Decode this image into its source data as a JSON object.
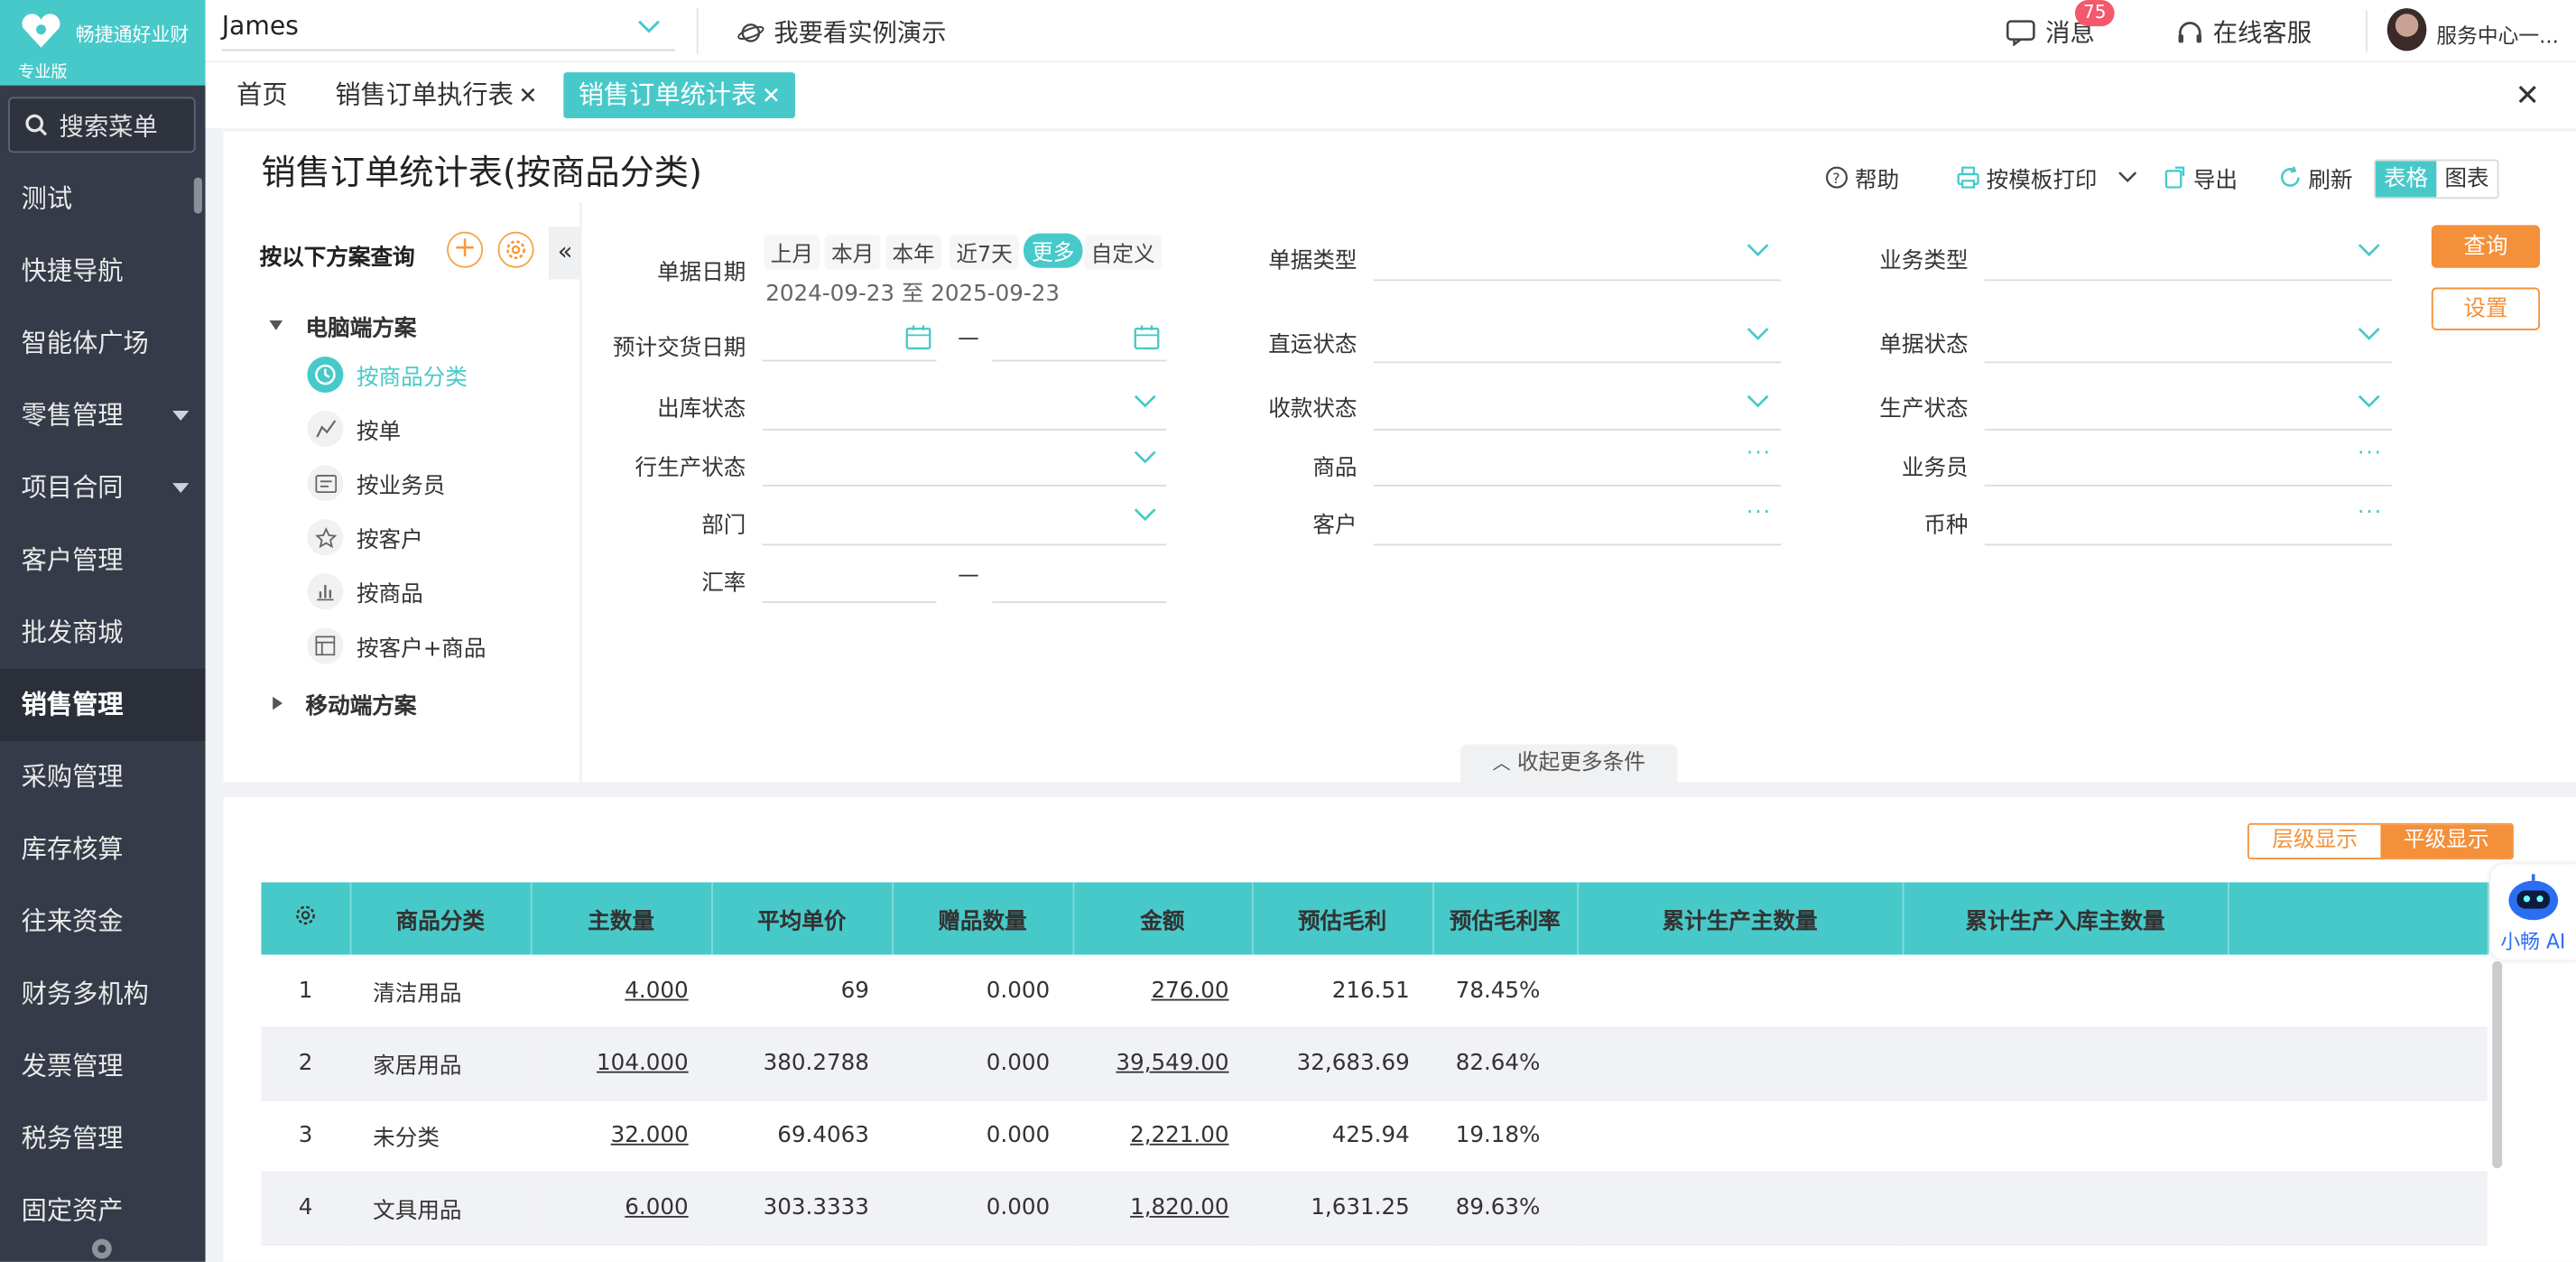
{
  "app": {
    "name": "畅捷通好业财",
    "edition": "专业版"
  },
  "sidebar": {
    "search_label": "搜索菜单",
    "items": [
      {
        "label": "测试"
      },
      {
        "label": "快捷导航"
      },
      {
        "label": "智能体广场"
      },
      {
        "label": "零售管理"
      },
      {
        "label": "项目合同"
      },
      {
        "label": "客户管理"
      },
      {
        "label": "批发商城"
      },
      {
        "label": "销售管理"
      },
      {
        "label": "采购管理"
      },
      {
        "label": "库存核算"
      },
      {
        "label": "往来资金"
      },
      {
        "label": "财务多机构"
      },
      {
        "label": "发票管理"
      },
      {
        "label": "税务管理"
      },
      {
        "label": "固定资产"
      }
    ],
    "active": "销售管理"
  },
  "topbar": {
    "account": "James",
    "demo": "我要看实例演示",
    "messages": "消息",
    "message_count": "75",
    "service": "在线客服",
    "user": "服务中心一..."
  },
  "tabs": [
    {
      "label": "首页",
      "closable": false
    },
    {
      "label": "销售订单执行表",
      "closable": true
    },
    {
      "label": "销售订单统计表",
      "closable": true,
      "active": true
    }
  ],
  "page": {
    "title": "销售订单统计表(按商品分类)",
    "toolbar": {
      "help": "帮助",
      "print": "按模板打印",
      "export": "导出",
      "refresh": "刷新",
      "view_table": "表格",
      "view_chart": "图表"
    },
    "scheme": {
      "title": "按以下方案查询",
      "group_pc": "电脑端方案",
      "items": [
        "按商品分类",
        "按单",
        "按业务员",
        "按客户",
        "按商品",
        "按客户+商品"
      ],
      "group_mobile": "移动端方案"
    },
    "filters": {
      "doc_date": "单据日期",
      "quick": [
        "上月",
        "本月",
        "本年",
        "近7天",
        "更多",
        "自定义"
      ],
      "date_range": "2024-09-23 至 2025-09-23",
      "delivery_date": "预计交货日期",
      "dash": "—",
      "outbound_status": "出库状态",
      "produce_status_row": "行生产状态",
      "department": "部门",
      "exchange_rate": "汇率",
      "doc_type": "单据类型",
      "direct_status": "直运状态",
      "collect_status": "收款状态",
      "product": "商品",
      "customer": "客户",
      "biz_type": "业务类型",
      "doc_status": "单据状态",
      "produce_status": "生产状态",
      "salesman": "业务员",
      "currency": "币种",
      "query": "查询",
      "settings": "设置",
      "collapse_more": "收起更多条件"
    }
  },
  "table_view": {
    "level": "层级显示",
    "flat": "平级显示"
  },
  "table": {
    "headers": [
      "商品分类",
      "主数量",
      "平均单价",
      "赠品数量",
      "金额",
      "预估毛利",
      "预估毛利率",
      "累计生产主数量",
      "累计生产入库主数量"
    ],
    "rows": [
      [
        "1",
        "清洁用品",
        "4.000",
        "69",
        "0.000",
        "276.00",
        "216.51",
        "78.45%",
        "",
        ""
      ],
      [
        "2",
        "家居用品",
        "104.000",
        "380.2788",
        "0.000",
        "39,549.00",
        "32,683.69",
        "82.64%",
        "",
        ""
      ],
      [
        "3",
        "未分类",
        "32.000",
        "69.4063",
        "0.000",
        "2,221.00",
        "425.94",
        "19.18%",
        "",
        ""
      ],
      [
        "4",
        "文具用品",
        "6.000",
        "303.3333",
        "0.000",
        "1,820.00",
        "1,631.25",
        "89.63%",
        "",
        ""
      ]
    ]
  },
  "assistant": {
    "label": "小畅 AI"
  },
  "colors": {
    "accent": "#48c9c9",
    "orange": "#f4903a",
    "sidebar": "#353b48"
  }
}
